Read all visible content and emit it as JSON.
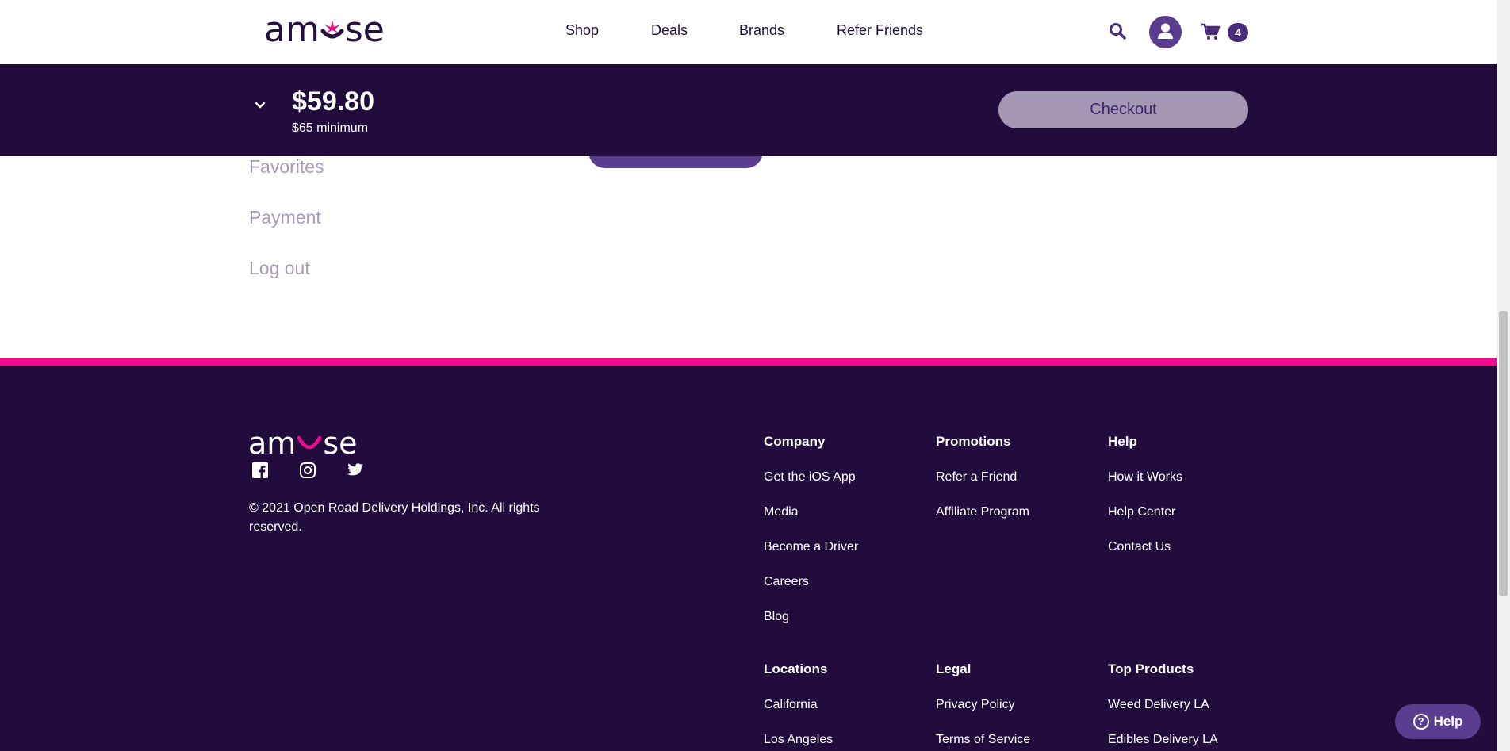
{
  "header": {
    "logo_text": "amuse",
    "nav": [
      "Shop",
      "Deals",
      "Brands",
      "Refer Friends"
    ],
    "cart_count": "4",
    "icons": [
      "search-icon",
      "user-icon",
      "cart-icon"
    ]
  },
  "cartbar": {
    "total": "$59.80",
    "minimum": "$65 minimum",
    "checkout_label": "Checkout"
  },
  "account_menu": [
    "Favorites",
    "Payment",
    "Log out"
  ],
  "footer": {
    "logo_text": "amuse",
    "social_icons": [
      "facebook-icon",
      "instagram-icon",
      "twitter-icon"
    ],
    "copyright": "© 2021 Open Road Delivery Holdings, Inc. All rights reserved.",
    "columns": [
      {
        "heading": "Company",
        "links": [
          "Get the iOS App",
          "Media",
          "Become a Driver",
          "Careers",
          "Blog"
        ]
      },
      {
        "heading": "Promotions",
        "links": [
          "Refer a Friend",
          "Affiliate Program"
        ]
      },
      {
        "heading": "Help",
        "links": [
          "How it Works",
          "Help Center",
          "Contact Us"
        ]
      },
      {
        "heading": "Locations",
        "links": [
          "California",
          "Los Angeles"
        ]
      },
      {
        "heading": "Legal",
        "links": [
          "Privacy Policy",
          "Terms of Service"
        ]
      },
      {
        "heading": "Top Products",
        "links": [
          "Weed Delivery LA",
          "Edibles Delivery LA"
        ]
      }
    ]
  },
  "help_widget": {
    "label": "Help"
  },
  "colors": {
    "brand_dark": "#220c3d",
    "accent_pink": "#ef0a8e",
    "purple": "#5b3d8f"
  }
}
